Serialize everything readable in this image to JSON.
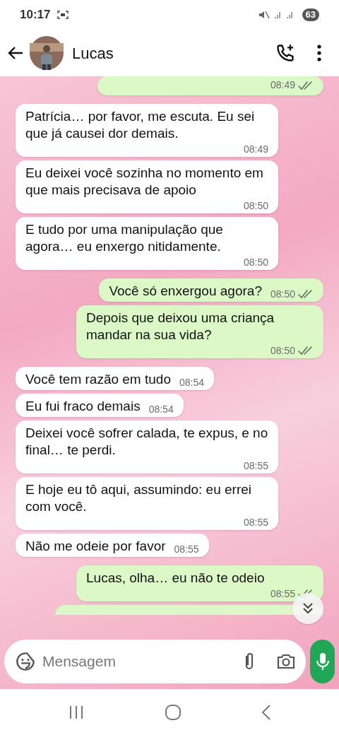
{
  "status_bar": {
    "time": "10:17",
    "battery": "63"
  },
  "header": {
    "contact_name": "Lucas"
  },
  "messages": [
    {
      "kind": "outgoing",
      "time": "08:49"
    },
    {
      "kind": "incoming",
      "text": "Patrícia… por favor, me escuta. Eu sei que já causei dor demais.",
      "time": "08:49"
    },
    {
      "kind": "incoming",
      "text": "Eu deixei você sozinha no momento em que mais precisava de apoio",
      "time": "08:50"
    },
    {
      "kind": "incoming",
      "text": "E tudo por uma manipulação que agora… eu enxergo nitidamente.",
      "time": "08:50"
    },
    {
      "kind": "outgoing",
      "text": "Você só enxergou agora?",
      "time": "08:50"
    },
    {
      "kind": "outgoing",
      "text": "Depois que deixou uma criança mandar na sua vida?",
      "time": "08:50"
    },
    {
      "kind": "incoming",
      "text": "Você tem razão em tudo",
      "time": "08:54"
    },
    {
      "kind": "incoming",
      "text": "Eu fui fraco demais",
      "time": "08:54"
    },
    {
      "kind": "incoming",
      "text": "Deixei você sofrer calada, te expus, e no final… te perdi.",
      "time": "08:55"
    },
    {
      "kind": "incoming",
      "text": "E hoje eu tô aqui, assumindo: eu errei com você.",
      "time": "08:55"
    },
    {
      "kind": "incoming",
      "text": "Não me odeie por favor",
      "time": "08:55"
    },
    {
      "kind": "outgoing",
      "text": "Lucas, olha… eu não te odeio",
      "time": "08:55"
    }
  ],
  "composer": {
    "placeholder": "Mensagem"
  }
}
